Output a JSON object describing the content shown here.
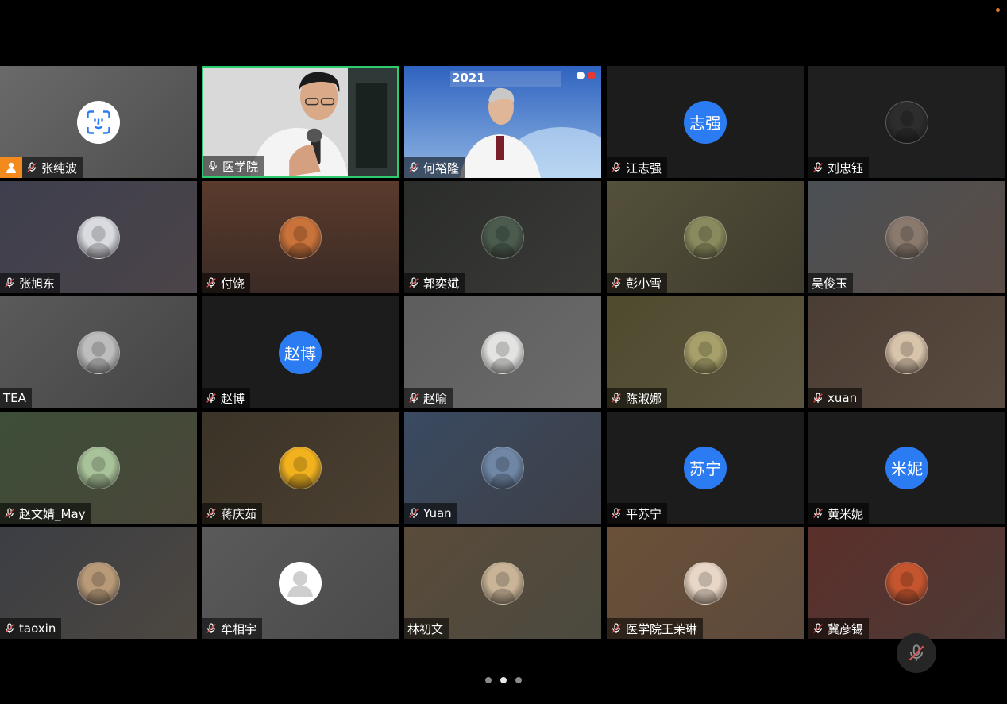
{
  "app": {
    "accent": "#2ecc71",
    "host_color": "#f28a1e"
  },
  "participants": [
    {
      "name": "张纯波",
      "mic": "muted",
      "host": true,
      "avatar": "face-id-icon",
      "bg": "linear-gradient(135deg,#6a6a6a,#4e4e4e)"
    },
    {
      "name": "医学院",
      "mic": "on",
      "host": false,
      "avatar": "video",
      "speaking": true,
      "bg": "#cfcfcf"
    },
    {
      "name": "何裕隆",
      "mic": "muted",
      "host": false,
      "avatar": "video",
      "bg": "#3d6fc4"
    },
    {
      "name": "江志强",
      "mic": "muted",
      "host": false,
      "avatar_text": "志强",
      "bg": "#1c1c1c"
    },
    {
      "name": "刘忠钰",
      "mic": "muted",
      "host": false,
      "avatar": "photo",
      "bg": "#1f1f1f",
      "photo": "#2d2d2d"
    },
    {
      "name": "张旭东",
      "mic": "muted",
      "host": false,
      "avatar": "photo",
      "bg": "linear-gradient(135deg,#3e3f4e,#4b4448)",
      "photo": "#d9dbe0"
    },
    {
      "name": "付饶",
      "mic": "muted",
      "host": false,
      "avatar": "photo",
      "bg": "linear-gradient(180deg,#5a3b2c,#3a2a25)",
      "photo": "#c9723a"
    },
    {
      "name": "郭奕斌",
      "mic": "muted",
      "host": false,
      "avatar": "photo",
      "bg": "linear-gradient(135deg,#2b2d2b,#3a3a37)",
      "photo": "#4b5b4d"
    },
    {
      "name": "彭小雪",
      "mic": "muted",
      "host": false,
      "avatar": "photo",
      "bg": "linear-gradient(135deg,#54503a,#3f3c2e)",
      "photo": "#8a8a5e"
    },
    {
      "name": "吴俊玉",
      "mic": "none",
      "host": false,
      "avatar": "photo",
      "bg": "linear-gradient(135deg,#4b5055,#5a4c45)",
      "photo": "#8a7a6e"
    },
    {
      "name": "TEA",
      "mic": "none",
      "host": false,
      "avatar": "photo",
      "bg": "linear-gradient(135deg,#5a5a5a,#444)",
      "photo": "#bdbdbd"
    },
    {
      "name": "赵博",
      "mic": "muted",
      "host": false,
      "avatar_text": "赵博",
      "bg": "#1c1c1c"
    },
    {
      "name": "赵喻",
      "mic": "muted",
      "host": false,
      "avatar": "photo",
      "bg": "linear-gradient(135deg,#5d5d5d,#6b6b6b)",
      "photo": "#e3e3e1"
    },
    {
      "name": "陈淑娜",
      "mic": "muted",
      "host": false,
      "avatar": "photo",
      "bg": "linear-gradient(135deg,#4f4a2e,#5c5540)",
      "photo": "#a7a06a"
    },
    {
      "name": "xuan",
      "mic": "muted",
      "host": false,
      "avatar": "photo",
      "bg": "linear-gradient(135deg,#4a3d33,#5a4b40)",
      "photo": "#d8c3ab"
    },
    {
      "name": "赵文婧_May",
      "mic": "muted",
      "host": false,
      "avatar": "photo",
      "bg": "linear-gradient(135deg,#3d4e38,#4a4639)",
      "photo": "#a8c29a"
    },
    {
      "name": "蒋庆茹",
      "mic": "muted",
      "host": false,
      "avatar": "photo",
      "bg": "linear-gradient(135deg,#3a3327,#4b4032)",
      "photo": "#f2b21e"
    },
    {
      "name": "Yuan",
      "mic": "muted",
      "host": false,
      "avatar": "photo",
      "bg": "linear-gradient(135deg,#3a4a62,#3d3f46)",
      "photo": "#6f86a4"
    },
    {
      "name": "平苏宁",
      "mic": "muted",
      "host": false,
      "avatar_text": "苏宁",
      "bg": "#1c1c1c"
    },
    {
      "name": "黄米妮",
      "mic": "muted",
      "host": false,
      "avatar_text": "米妮",
      "bg": "#1c1c1c"
    },
    {
      "name": "taoxin",
      "mic": "muted",
      "host": false,
      "avatar": "photo",
      "bg": "linear-gradient(135deg,#3b3e44,#4d4740)",
      "photo": "#b99a78"
    },
    {
      "name": "牟相宇",
      "mic": "muted",
      "host": false,
      "avatar": "person-placeholder-icon",
      "bg": "linear-gradient(135deg,#5a5a5a,#4a4a4a)"
    },
    {
      "name": "林初文",
      "mic": "none",
      "host": false,
      "avatar": "photo",
      "bg": "linear-gradient(135deg,#5a4b3a,#4b4a3f)",
      "photo": "#c9b498"
    },
    {
      "name": "医学院王茉琳",
      "mic": "muted",
      "host": false,
      "avatar": "photo",
      "bg": "linear-gradient(135deg,#6a5038,#5c4a3c)",
      "photo": "#e8d7c6"
    },
    {
      "name": "冀彦锡",
      "mic": "muted",
      "host": false,
      "avatar": "photo",
      "bg": "linear-gradient(135deg,#5b2f2a,#4d3a36)",
      "photo": "#c4552e"
    }
  ],
  "pager": {
    "pages": 3,
    "current": 2
  }
}
